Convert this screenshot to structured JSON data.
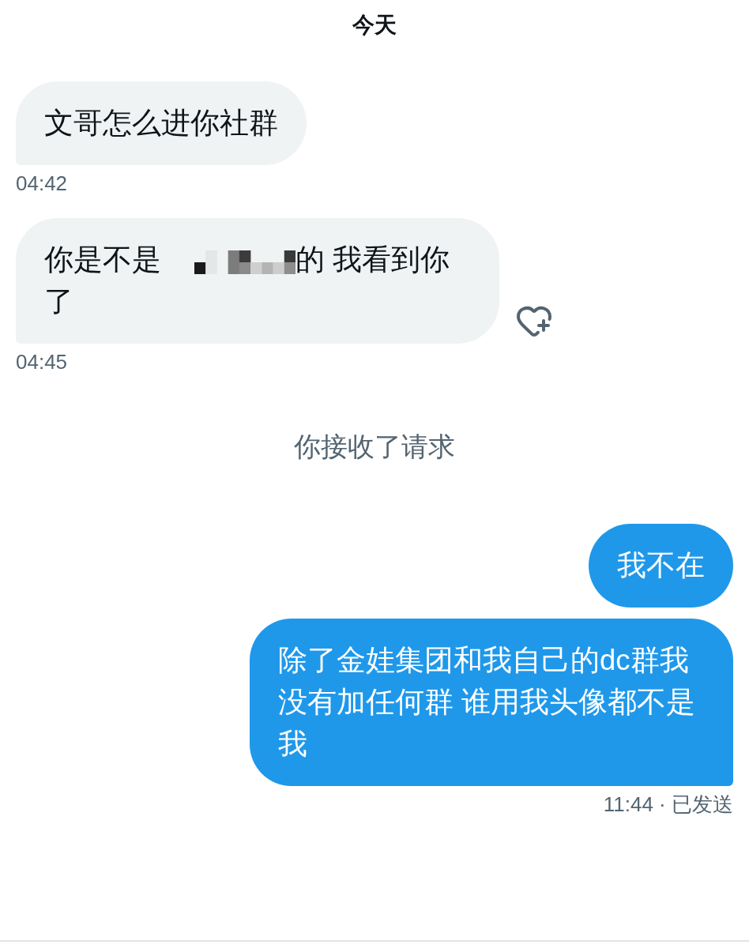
{
  "date_header": "今天",
  "conversation": [
    {
      "kind": "incoming",
      "messages": [
        {
          "segments": [
            {
              "kind": "text",
              "text": "文哥怎么进你社群"
            }
          ],
          "reaction_button": false
        }
      ],
      "time": "04:42"
    },
    {
      "kind": "incoming",
      "messages": [
        {
          "segments": [
            {
              "kind": "text",
              "text": "你是不是"
            },
            {
              "kind": "redacted"
            },
            {
              "kind": "text",
              "text": "的 我看到你"
            },
            {
              "kind": "text",
              "text": "了"
            }
          ],
          "reaction_button": true
        }
      ],
      "time": "04:45"
    },
    {
      "kind": "event",
      "text": "你接收了请求"
    },
    {
      "kind": "outgoing",
      "messages": [
        {
          "segments": [
            {
              "kind": "text",
              "text": "我不在"
            }
          ],
          "reaction_button": false
        },
        {
          "segments": [
            {
              "kind": "text",
              "text": "除了金娃集团和我自己的dc群我没有加任何群 谁用我头像都不是我"
            }
          ],
          "reaction_button": false
        }
      ],
      "time": "11:44 · 已发送"
    }
  ]
}
